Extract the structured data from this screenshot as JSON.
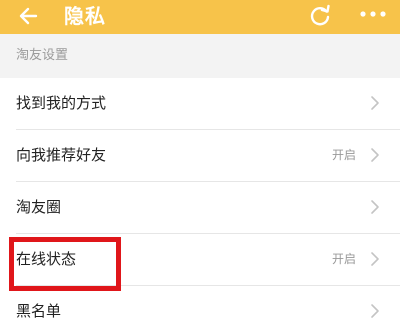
{
  "header": {
    "title": "隐私",
    "back_icon": "back-arrow-icon",
    "refresh_icon": "refresh-icon",
    "more_icon": "more-dots-icon",
    "background_color": "#f7c34a"
  },
  "section": {
    "label": "淘友设置"
  },
  "rows": [
    {
      "label": "找到我的方式",
      "value": ""
    },
    {
      "label": "向我推荐好友",
      "value": "开启"
    },
    {
      "label": "淘友圈",
      "value": ""
    },
    {
      "label": "在线状态",
      "value": "开启"
    },
    {
      "label": "黑名单",
      "value": ""
    }
  ],
  "highlight_color": "#e0161a"
}
